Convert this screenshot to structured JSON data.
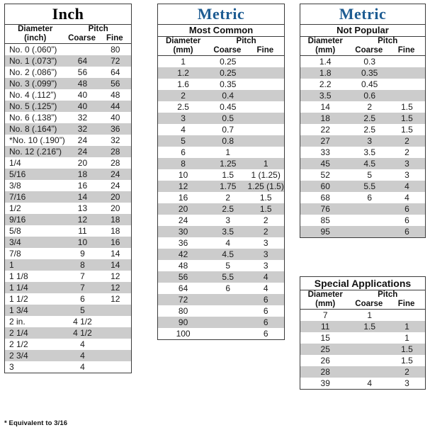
{
  "columns": {
    "diameter_inch": "Diameter",
    "diameter_inch_unit": "(inch)",
    "diameter_mm": "Diameter",
    "diameter_mm_unit": "(mm)",
    "pitch": "Pitch",
    "coarse": "Coarse",
    "fine": "Fine"
  },
  "inch_table": {
    "title": "Inch",
    "rows": [
      {
        "diameter": "No. 0 (.060”)",
        "coarse": "",
        "fine": "80"
      },
      {
        "diameter": "No. 1 (.073”)",
        "coarse": "64",
        "fine": "72"
      },
      {
        "diameter": "No. 2 (.086”)",
        "coarse": "56",
        "fine": "64"
      },
      {
        "diameter": "No. 3 (.099”)",
        "coarse": "48",
        "fine": "56"
      },
      {
        "diameter": "No. 4 (.112”)",
        "coarse": "40",
        "fine": "48"
      },
      {
        "diameter": "No. 5 (.125”)",
        "coarse": "40",
        "fine": "44"
      },
      {
        "diameter": "No. 6 (.138”)",
        "coarse": "32",
        "fine": "40"
      },
      {
        "diameter": "No. 8 (.164”)",
        "coarse": "32",
        "fine": "36"
      },
      {
        "diameter": "*No. 10 (.190”)",
        "coarse": "24",
        "fine": "32"
      },
      {
        "diameter": "No. 12 (.216”)",
        "coarse": "24",
        "fine": "28"
      },
      {
        "diameter": "1/4",
        "coarse": "20",
        "fine": "28"
      },
      {
        "diameter": "5/16",
        "coarse": "18",
        "fine": "24"
      },
      {
        "diameter": "3/8",
        "coarse": "16",
        "fine": "24"
      },
      {
        "diameter": "7/16",
        "coarse": "14",
        "fine": "20"
      },
      {
        "diameter": "1/2",
        "coarse": "13",
        "fine": "20"
      },
      {
        "diameter": "9/16",
        "coarse": "12",
        "fine": "18"
      },
      {
        "diameter": "5/8",
        "coarse": "11",
        "fine": "18"
      },
      {
        "diameter": "3/4",
        "coarse": "10",
        "fine": "16"
      },
      {
        "diameter": "7/8",
        "coarse": "9",
        "fine": "14"
      },
      {
        "diameter": "1",
        "coarse": "8",
        "fine": "14"
      },
      {
        "diameter": "1 1/8",
        "coarse": "7",
        "fine": "12"
      },
      {
        "diameter": "1 1/4",
        "coarse": "7",
        "fine": "12"
      },
      {
        "diameter": "1 1/2",
        "coarse": "6",
        "fine": "12"
      },
      {
        "diameter": "1 3/4",
        "coarse": "5",
        "fine": ""
      },
      {
        "diameter": "2 in.",
        "coarse": "4 1/2",
        "fine": ""
      },
      {
        "diameter": "2 1/4",
        "coarse": "4 1/2",
        "fine": ""
      },
      {
        "diameter": "2 1/2",
        "coarse": "4",
        "fine": ""
      },
      {
        "diameter": "2 3/4",
        "coarse": "4",
        "fine": ""
      },
      {
        "diameter": "3",
        "coarse": "4",
        "fine": ""
      }
    ],
    "footnote": "* Equivalent to 3/16"
  },
  "metric_common_table": {
    "title": "Metric",
    "subtitle": "Most Common",
    "rows": [
      {
        "diameter": "1",
        "coarse": "0.25",
        "fine": ""
      },
      {
        "diameter": "1.2",
        "coarse": "0.25",
        "fine": ""
      },
      {
        "diameter": "1.6",
        "coarse": "0.35",
        "fine": ""
      },
      {
        "diameter": "2",
        "coarse": "0.4",
        "fine": ""
      },
      {
        "diameter": "2.5",
        "coarse": "0.45",
        "fine": ""
      },
      {
        "diameter": "3",
        "coarse": "0.5",
        "fine": ""
      },
      {
        "diameter": "4",
        "coarse": "0.7",
        "fine": ""
      },
      {
        "diameter": "5",
        "coarse": "0.8",
        "fine": ""
      },
      {
        "diameter": "6",
        "coarse": "1",
        "fine": ""
      },
      {
        "diameter": "8",
        "coarse": "1.25",
        "fine": "1"
      },
      {
        "diameter": "10",
        "coarse": "1.5",
        "fine": "1 (1.25)"
      },
      {
        "diameter": "12",
        "coarse": "1.75",
        "fine": "1.25 (1.5)"
      },
      {
        "diameter": "16",
        "coarse": "2",
        "fine": "1.5"
      },
      {
        "diameter": "20",
        "coarse": "2.5",
        "fine": "1.5"
      },
      {
        "diameter": "24",
        "coarse": "3",
        "fine": "2"
      },
      {
        "diameter": "30",
        "coarse": "3.5",
        "fine": "2"
      },
      {
        "diameter": "36",
        "coarse": "4",
        "fine": "3"
      },
      {
        "diameter": "42",
        "coarse": "4.5",
        "fine": "3"
      },
      {
        "diameter": "48",
        "coarse": "5",
        "fine": "3"
      },
      {
        "diameter": "56",
        "coarse": "5.5",
        "fine": "4"
      },
      {
        "diameter": "64",
        "coarse": "6",
        "fine": "4"
      },
      {
        "diameter": "72",
        "coarse": "",
        "fine": "6"
      },
      {
        "diameter": "80",
        "coarse": "",
        "fine": "6"
      },
      {
        "diameter": "90",
        "coarse": "",
        "fine": "6"
      },
      {
        "diameter": "100",
        "coarse": "",
        "fine": "6"
      }
    ]
  },
  "metric_notpopular_table": {
    "title": "Metric",
    "subtitle": "Not Popular",
    "rows": [
      {
        "diameter": "1.4",
        "coarse": "0.3",
        "fine": ""
      },
      {
        "diameter": "1.8",
        "coarse": "0.35",
        "fine": ""
      },
      {
        "diameter": "2.2",
        "coarse": "0.45",
        "fine": ""
      },
      {
        "diameter": "3.5",
        "coarse": "0.6",
        "fine": ""
      },
      {
        "diameter": "14",
        "coarse": "2",
        "fine": "1.5"
      },
      {
        "diameter": "18",
        "coarse": "2.5",
        "fine": "1.5"
      },
      {
        "diameter": "22",
        "coarse": "2.5",
        "fine": "1.5"
      },
      {
        "diameter": "27",
        "coarse": "3",
        "fine": "2"
      },
      {
        "diameter": "33",
        "coarse": "3.5",
        "fine": "2"
      },
      {
        "diameter": "45",
        "coarse": "4.5",
        "fine": "3"
      },
      {
        "diameter": "52",
        "coarse": "5",
        "fine": "3"
      },
      {
        "diameter": "60",
        "coarse": "5.5",
        "fine": "4"
      },
      {
        "diameter": "68",
        "coarse": "6",
        "fine": "4"
      },
      {
        "diameter": "76",
        "coarse": "",
        "fine": "6"
      },
      {
        "diameter": "85",
        "coarse": "",
        "fine": "6"
      },
      {
        "diameter": "95",
        "coarse": "",
        "fine": "6"
      }
    ]
  },
  "special_table": {
    "title": "Special Applications",
    "rows": [
      {
        "diameter": "7",
        "coarse": "1",
        "fine": ""
      },
      {
        "diameter": "11",
        "coarse": "1.5",
        "fine": "1"
      },
      {
        "diameter": "15",
        "coarse": "",
        "fine": "1"
      },
      {
        "diameter": "25",
        "coarse": "",
        "fine": "1.5"
      },
      {
        "diameter": "26",
        "coarse": "",
        "fine": "1.5"
      },
      {
        "diameter": "28",
        "coarse": "",
        "fine": "2"
      },
      {
        "diameter": "39",
        "coarse": "4",
        "fine": "3"
      }
    ]
  },
  "colors": {
    "metric_title": "#1e5c92",
    "inch_title": "#000000",
    "row_shade": "#cccccc",
    "border": "#3b3b3b"
  }
}
